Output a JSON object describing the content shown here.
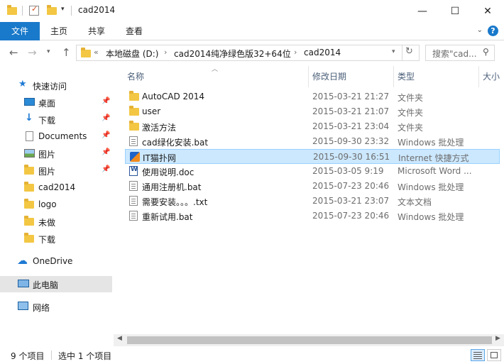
{
  "window": {
    "title": "cad2014",
    "controls": {
      "minimize": "—",
      "maximize": "☐",
      "close": "✕"
    }
  },
  "ribbon": {
    "tabs": [
      "文件",
      "主页",
      "共享",
      "查看"
    ],
    "help": "?"
  },
  "address": {
    "overflow": "«",
    "crumbs": [
      "本地磁盘 (D:)",
      "cad2014纯净绿色版32+64位",
      "cad2014"
    ],
    "refresh": "↻"
  },
  "search": {
    "placeholder": "搜索\"cad..."
  },
  "nav": {
    "quick_access": "快速访问",
    "items": [
      {
        "label": "桌面",
        "pinned": true
      },
      {
        "label": "下载",
        "pinned": true
      },
      {
        "label": "Documents",
        "pinned": true
      },
      {
        "label": "图片",
        "pinned": true
      },
      {
        "label": "图片",
        "pinned": true
      },
      {
        "label": "cad2014",
        "pinned": false
      },
      {
        "label": "logo",
        "pinned": false
      },
      {
        "label": "未做",
        "pinned": false
      },
      {
        "label": "下载",
        "pinned": false
      }
    ],
    "onedrive": "OneDrive",
    "this_pc": "此电脑",
    "network": "网络"
  },
  "columns": {
    "name": "名称",
    "date": "修改日期",
    "type": "类型",
    "size": "大小"
  },
  "files": [
    {
      "name": "AutoCAD 2014",
      "date": "2015-03-21 21:27",
      "type": "文件夹",
      "icon": "folder-icon"
    },
    {
      "name": "user",
      "date": "2015-03-21 21:07",
      "type": "文件夹",
      "icon": "folder-icon"
    },
    {
      "name": "激活方法",
      "date": "2015-03-21 23:04",
      "type": "文件夹",
      "icon": "folder-icon"
    },
    {
      "name": "cad绿化安装.bat",
      "date": "2015-09-30 23:32",
      "type": "Windows 批处理",
      "icon": "batch-file-icon"
    },
    {
      "name": "IT猫扑网",
      "date": "2015-09-30 16:51",
      "type": "Internet 快捷方式",
      "icon": "internet-shortcut-icon",
      "selected": true
    },
    {
      "name": "使用说明.doc",
      "date": "2015-03-05 9:19",
      "type": "Microsoft Word ...",
      "icon": "word-document-icon"
    },
    {
      "name": "通用注册机.bat",
      "date": "2015-07-23 20:46",
      "type": "Windows 批处理",
      "icon": "batch-file-icon"
    },
    {
      "name": "需要安装。。。.txt",
      "date": "2015-03-21 23:07",
      "type": "文本文档",
      "icon": "text-file-icon"
    },
    {
      "name": "重新试用.bat",
      "date": "2015-07-23 20:46",
      "type": "Windows 批处理",
      "icon": "batch-file-icon"
    }
  ],
  "status": {
    "count": "9 个项目",
    "selection": "选中 1 个项目"
  },
  "colors": {
    "accent": "#1979ca",
    "selection_bg": "#cce8ff",
    "selection_border": "#99d1ff",
    "folder": "#f3c744"
  }
}
